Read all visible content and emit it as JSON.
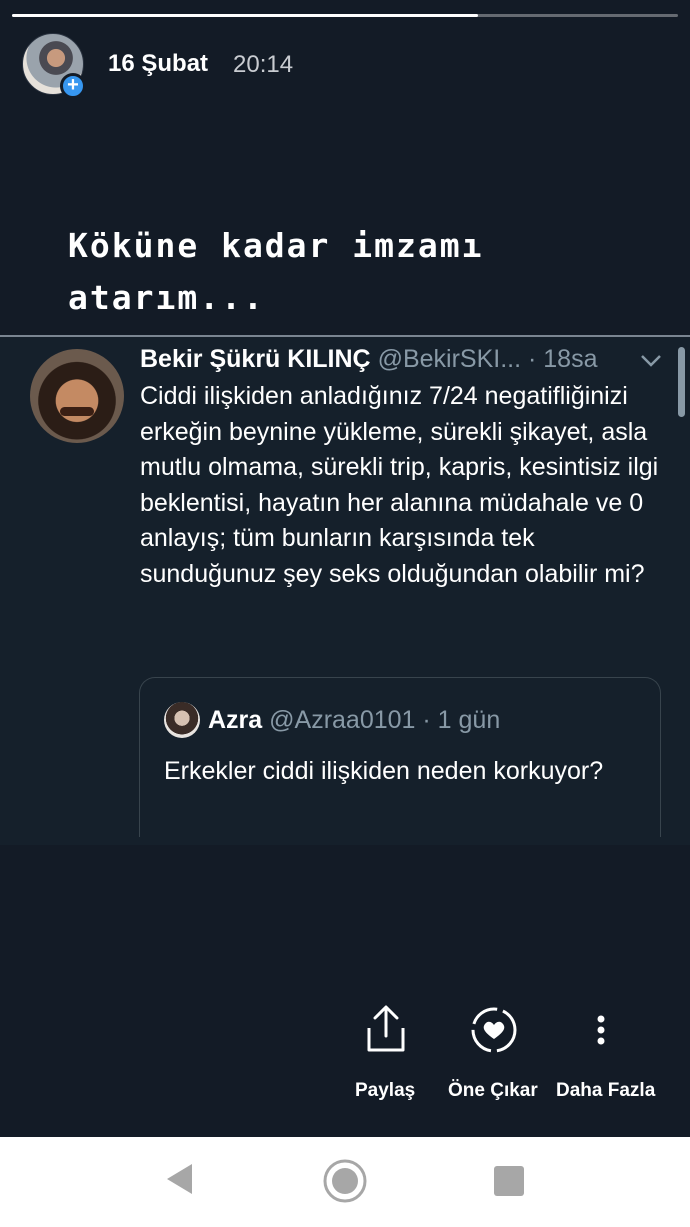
{
  "story": {
    "progress": 0.7,
    "username": "16 Şubat",
    "timestamp": "20:14",
    "caption": "Köküne kadar imzamı atarım..."
  },
  "tweet": {
    "name": "Bekir Şükrü KILINÇ",
    "handle": "@BekirSKI...",
    "time": "· 18sa",
    "text": "Ciddi ilişkiden anladığınız 7/24 negatifliğinizi erkeğin beynine yükleme, sürekli şikayet, asla mutlu olmama, sürekli trip, kapris, kesintisiz ilgi beklentisi, hayatın her alanına müdahale ve 0 anlayış; tüm bunların karşısında tek sunduğunuz şey seks olduğundan olabilir mi?",
    "quote": {
      "name": "Azra",
      "handle": "@Azraa0101",
      "time": "· 1 gün",
      "text": "Erkekler ciddi ilişkiden neden korkuyor?"
    }
  },
  "actions": {
    "share_label": "Paylaş",
    "highlight_label": "Öne Çıkar",
    "more_label": "Daha Fazla"
  },
  "icons": {
    "avatar_badge": "plus-icon",
    "share": "share-icon",
    "highlight": "heart-circle-icon",
    "more": "more-vertical-icon",
    "nav_back": "back-triangle-icon",
    "nav_home": "home-circle-icon",
    "nav_recent": "recent-square-icon"
  },
  "colors": {
    "story_background": "#131b26",
    "tweet_background": "#15202b",
    "badge": "#3797f0",
    "muted_text": "#8899a6"
  }
}
